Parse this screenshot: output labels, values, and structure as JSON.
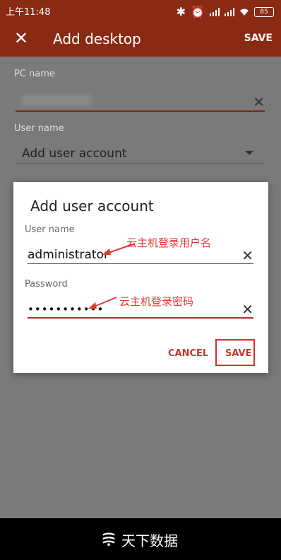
{
  "status_bar": {
    "time": "上午11:48",
    "battery": "85",
    "icons": [
      "bluetooth-icon",
      "alarm-icon",
      "signal-icon",
      "signal-icon",
      "wifi-icon",
      "battery-icon"
    ]
  },
  "toolbar": {
    "close_icon": "close-icon",
    "title": "Add desktop",
    "save": "SAVE"
  },
  "form": {
    "pc_label": "PC name",
    "pc_clear_icon": "close-icon",
    "user_label": "User name",
    "user_value": "Add user account"
  },
  "dialog": {
    "title": "Add user account",
    "username_label": "User name",
    "username_value": "administrator",
    "password_label": "Password",
    "password_value": "•••••••••••",
    "cancel": "CANCEL",
    "save": "SAVE"
  },
  "annotations": {
    "username": "云主机登录用户名",
    "password": "云主机登录密码"
  },
  "footer": {
    "brand": "天下数据"
  },
  "colors": {
    "primary": "#8a2a14",
    "accent": "#c62828"
  }
}
